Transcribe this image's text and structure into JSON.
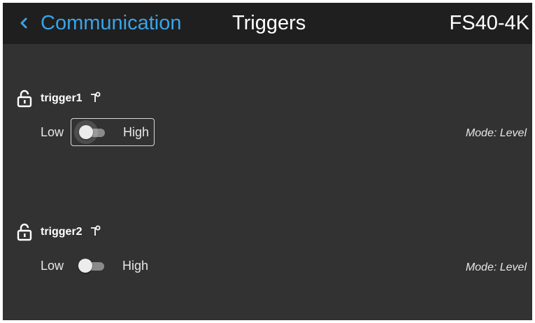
{
  "header": {
    "back_label": "Communication",
    "title": "Triggers",
    "device": "FS40-4K"
  },
  "triggers": [
    {
      "name": "trigger1",
      "low_label": "Low",
      "high_label": "High",
      "state": "Low",
      "mode": "Mode: Level",
      "focused": true
    },
    {
      "name": "trigger2",
      "low_label": "Low",
      "high_label": "High",
      "state": "Low",
      "mode": "Mode: Level",
      "focused": false
    }
  ],
  "colors": {
    "accent": "#3aa3e8",
    "background": "#323232",
    "header_background": "#1f1f1f"
  },
  "icons": {
    "back": "chevron-left-icon",
    "lock": "unlock-icon",
    "connector": "plug-icon"
  }
}
